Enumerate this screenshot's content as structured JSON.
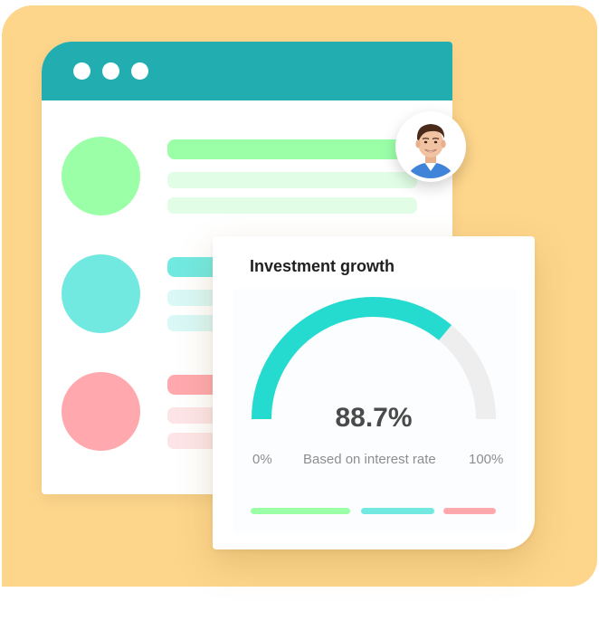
{
  "colors": {
    "backdrop": "#fdd58b",
    "titlebar": "#22aeb0",
    "green": "#9bffa8",
    "green_light": "#e1fde5",
    "teal": "#72e9e0",
    "teal_light": "#d9f8f6",
    "red": "#ffa9ae",
    "red_light": "#fde5e7",
    "gauge_fill": "#25dbd0",
    "gauge_track": "#eeeeee"
  },
  "avatar": {
    "icon": "user-avatar-photo"
  },
  "card": {
    "title": "Investment growth",
    "value_text": "88.7%",
    "gauge_fraction": 0.72,
    "min_label": "0%",
    "center_label": "Based on interest rate",
    "max_label": "100%"
  }
}
